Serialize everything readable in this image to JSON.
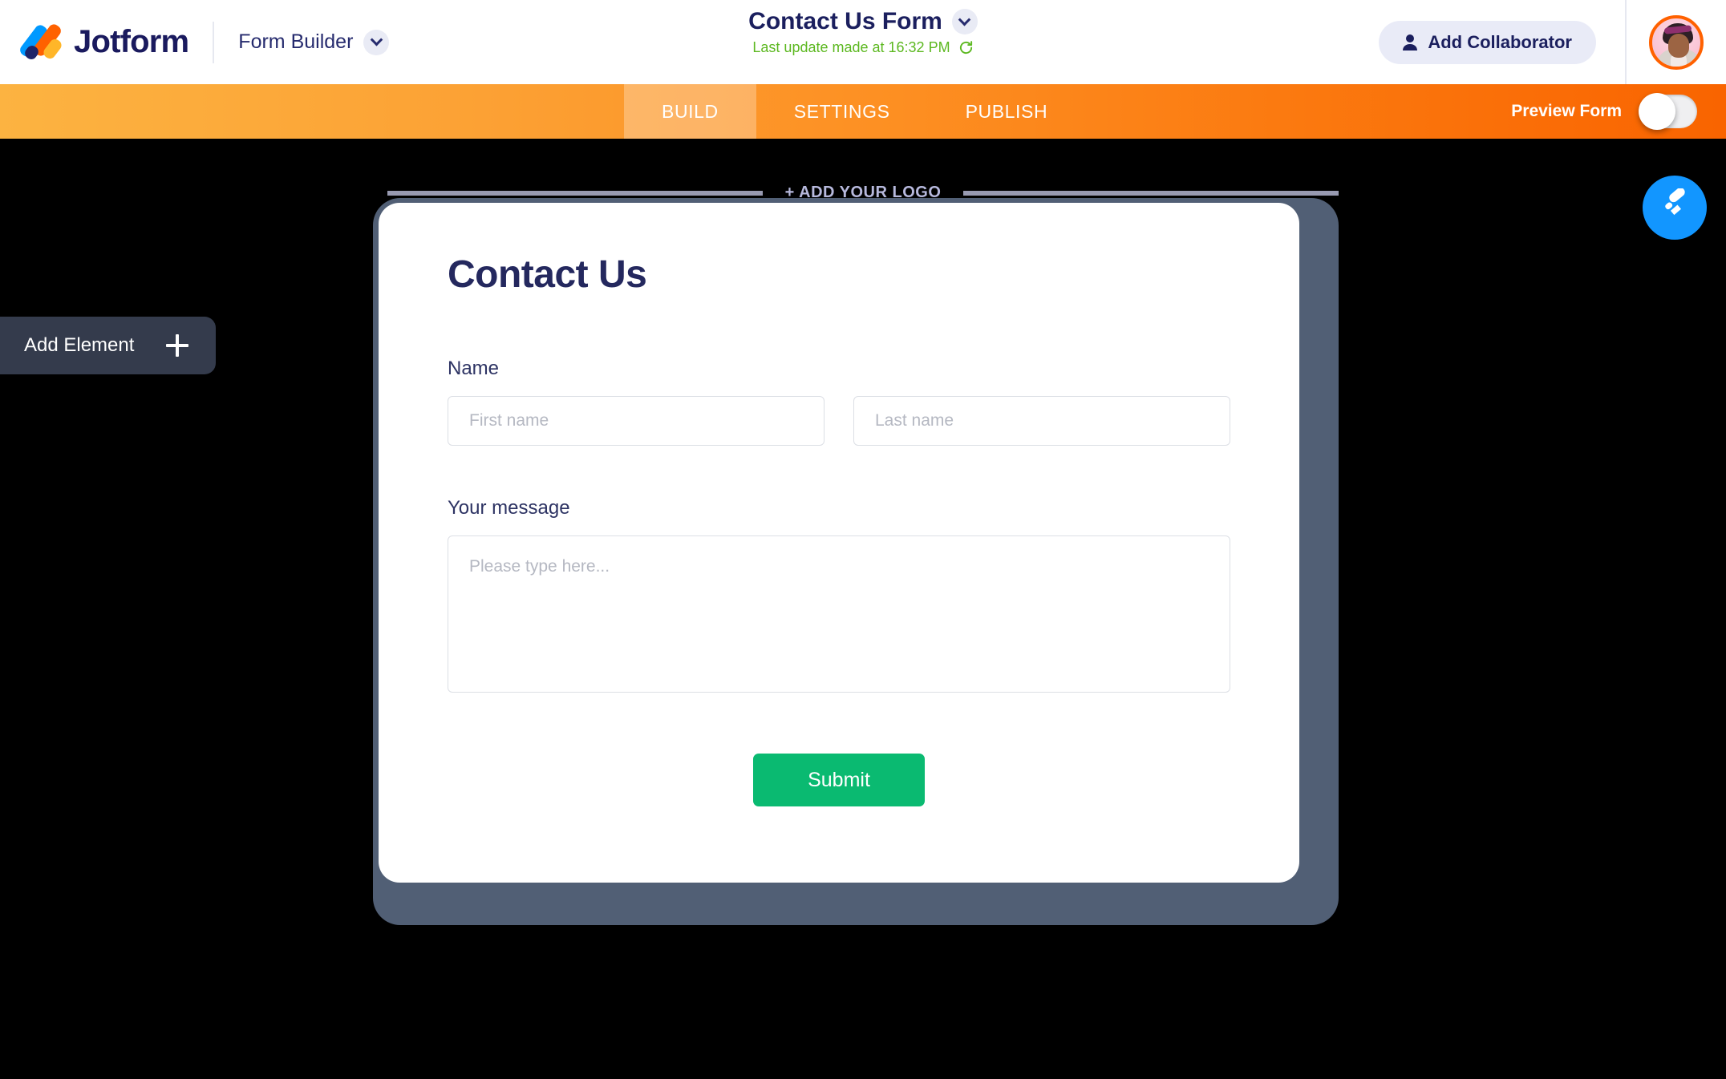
{
  "header": {
    "brand_name": "Jotform",
    "brand_logo_icon": "jotform-logo-icon",
    "form_builder_label": "Form Builder",
    "form_builder_chevron_icon": "chevron-down-icon",
    "form_title": "Contact Us Form",
    "form_title_chevron_icon": "chevron-down-icon",
    "last_update_text": "Last update made at 16:32 PM",
    "refresh_icon": "refresh-icon",
    "add_collaborator_label": "Add Collaborator",
    "add_collaborator_icon": "person-icon",
    "avatar_name": "user-avatar"
  },
  "nav": {
    "tabs": [
      {
        "label": "BUILD",
        "active": true
      },
      {
        "label": "SETTINGS",
        "active": false
      },
      {
        "label": "PUBLISH",
        "active": false
      }
    ],
    "preview_label": "Preview Form",
    "preview_toggle_state": "off"
  },
  "canvas": {
    "add_element_label": "Add Element",
    "add_element_icon": "plus-icon",
    "designer_button_icon": "paint-roller-icon",
    "add_logo_label": "+ ADD YOUR LOGO"
  },
  "form": {
    "title": "Contact Us",
    "fields": [
      {
        "label": "Name",
        "inputs": [
          {
            "name": "first-name",
            "placeholder": "First name",
            "value": ""
          },
          {
            "name": "last-name",
            "placeholder": "Last name",
            "value": ""
          }
        ]
      },
      {
        "label": "Your message",
        "inputs": [
          {
            "name": "message",
            "placeholder": "Please type here...",
            "value": ""
          }
        ]
      }
    ],
    "submit_label": "Submit"
  },
  "colors": {
    "brand_navy": "#1a1a5e",
    "orange_start": "#fcb341",
    "orange_end": "#f96400",
    "green_status": "#5cb820",
    "submit_green": "#0aba71",
    "designer_blue": "#1296ff",
    "add_element_slate": "#343b4c",
    "card_frame_slate": "#515f75"
  }
}
